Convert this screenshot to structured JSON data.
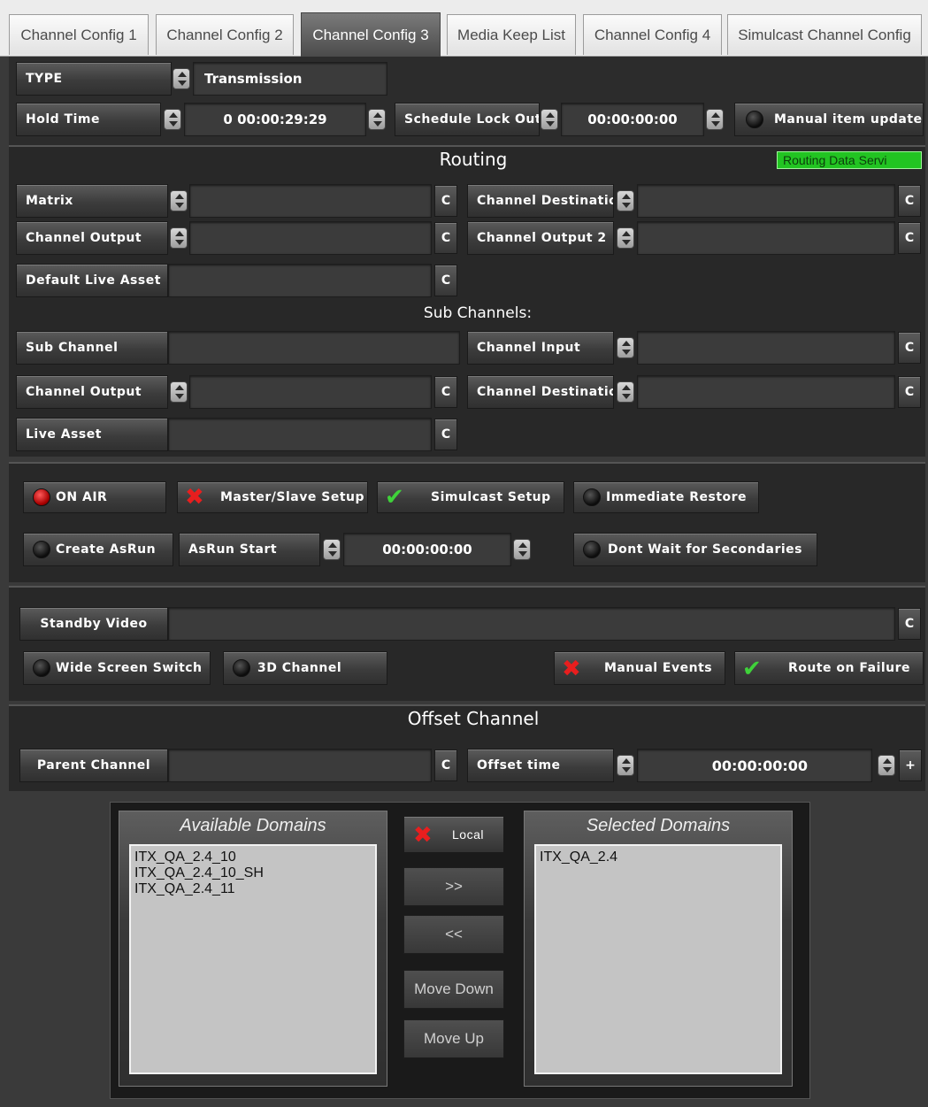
{
  "tabs": [
    "Channel Config 1",
    "Channel Config 2",
    "Channel Config 3",
    "Media Keep List",
    "Channel Config 4",
    "Simulcast Channel Config"
  ],
  "top": {
    "type_label": "TYPE",
    "type_value": "Transmission",
    "hold_time_label": "Hold Time",
    "hold_time_value": "0 00:00:29:29",
    "schedule_lockout_label": "Schedule Lock Out",
    "schedule_lockout_value": "00:00:00:00",
    "manual_updates_label": "Manual item updates"
  },
  "routing": {
    "title": "Routing",
    "status": "Routing Data Servi",
    "status_color": "#22c422",
    "matrix_label": "Matrix",
    "channel_destination_label": "Channel Destination",
    "channel_output_label": "Channel Output",
    "channel_output2_label": "Channel Output 2",
    "default_live_asset_label": "Default Live Asset",
    "c_label": "C"
  },
  "sub_channels": {
    "title": "Sub Channels:",
    "sub_channel_label": "Sub Channel",
    "channel_input_label": "Channel Input",
    "channel_output_label": "Channel Output",
    "channel_destination_label": "Channel Destination",
    "live_asset_label": "Live Asset"
  },
  "controls": {
    "on_air": "ON AIR",
    "master_slave": "Master/Slave Setup",
    "simulcast": "Simulcast Setup",
    "immediate_restore": "Immediate Restore",
    "create_asrun": "Create AsRun",
    "asrun_start_label": "AsRun Start",
    "asrun_start_value": "00:00:00:00",
    "dont_wait": "Dont Wait for Secondaries"
  },
  "standby": {
    "standby_video_label": "Standby Video",
    "wide_screen": "Wide Screen Switch",
    "channel_3d": "3D Channel",
    "manual_events": "Manual Events",
    "route_on_failure": "Route on Failure"
  },
  "offset": {
    "title": "Offset Channel",
    "parent_channel_label": "Parent Channel",
    "offset_time_label": "Offset time",
    "offset_time_value": "00:00:00:00",
    "plus": "+"
  },
  "domains": {
    "available_title": "Available Domains",
    "available": [
      "ITX_QA_2.4_10",
      "ITX_QA_2.4_10_SH",
      "ITX_QA_2.4_11"
    ],
    "selected_title": "Selected Domains",
    "selected": [
      "ITX_QA_2.4"
    ],
    "local_label": "Local",
    "add_label": ">>",
    "remove_label": "<<",
    "move_down_label": "Move Down",
    "move_up_label": "Move Up"
  },
  "icons": {
    "x_mark": "x-icon",
    "check_mark": "check-icon",
    "spin": "spinner-icon",
    "led": "led-indicator"
  }
}
